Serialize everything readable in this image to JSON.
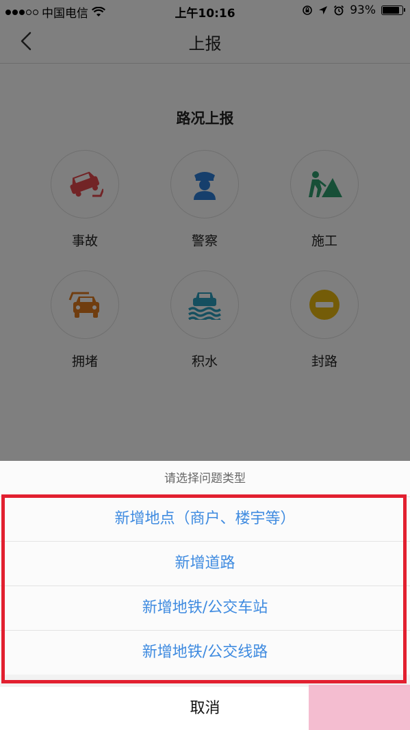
{
  "status_bar": {
    "carrier": "中国电信",
    "time": "上午10:16",
    "battery_text": "93%",
    "battery_level": 0.93
  },
  "nav": {
    "title": "上报",
    "back_icon": "chevron-left-icon"
  },
  "report": {
    "section_title": "路况上报",
    "items": [
      {
        "label": "事故",
        "icon": "car-accident-icon",
        "color": "#e5484d"
      },
      {
        "label": "警察",
        "icon": "police-icon",
        "color": "#2d7fd8"
      },
      {
        "label": "施工",
        "icon": "construction-icon",
        "color": "#2e9e6f"
      },
      {
        "label": "拥堵",
        "icon": "traffic-jam-icon",
        "color": "#e07b1e"
      },
      {
        "label": "积水",
        "icon": "flooding-icon",
        "color": "#2a9fbf"
      },
      {
        "label": "封路",
        "icon": "road-closed-icon",
        "color": "#e8b810"
      }
    ]
  },
  "action_sheet": {
    "title": "请选择问题类型",
    "options": [
      "新增地点（商户、楼宇等）",
      "新增道路",
      "新增地铁/公交车站",
      "新增地铁/公交线路"
    ],
    "cancel_label": "取消",
    "highlight_color": "#e22030",
    "option_color": "#3f8be0"
  }
}
